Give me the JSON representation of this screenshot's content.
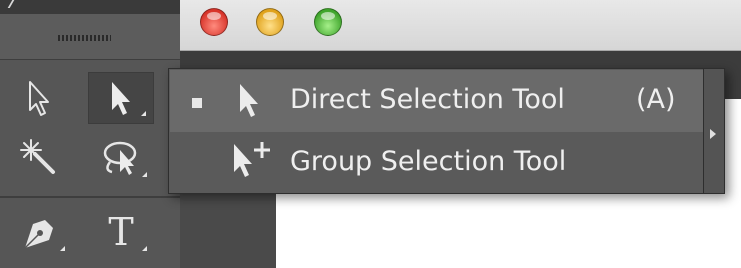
{
  "window": {
    "buttons": [
      "close",
      "minimize",
      "zoom"
    ]
  },
  "tools_panel": {
    "tools": [
      {
        "name": "Selection Tool",
        "icon": "selection-arrow-icon"
      },
      {
        "name": "Direct Selection Tool",
        "icon": "direct-selection-arrow-icon",
        "selected": true
      },
      {
        "name": "Magic Wand Tool",
        "icon": "magic-wand-icon"
      },
      {
        "name": "Lasso Tool",
        "icon": "lasso-icon"
      },
      {
        "name": "Pen Tool",
        "icon": "pen-icon"
      },
      {
        "name": "Type Tool",
        "icon": "type-icon",
        "glyph": "T"
      }
    ]
  },
  "flyout": {
    "items": [
      {
        "label": "Direct Selection Tool",
        "shortcut": "(A)",
        "checked": true,
        "icon": "direct-selection-arrow-icon"
      },
      {
        "label": "Group Selection Tool",
        "shortcut": "",
        "checked": false,
        "icon": "group-selection-arrow-icon"
      }
    ],
    "tearoff_icon": "tearoff-arrow-icon"
  },
  "colors": {
    "panel": "#565656",
    "menu_highlight": "#6a6a6a",
    "canvas": "#ffffff",
    "close": "#e0443e",
    "minimize": "#f4b72d",
    "zoom": "#5cc43a"
  }
}
